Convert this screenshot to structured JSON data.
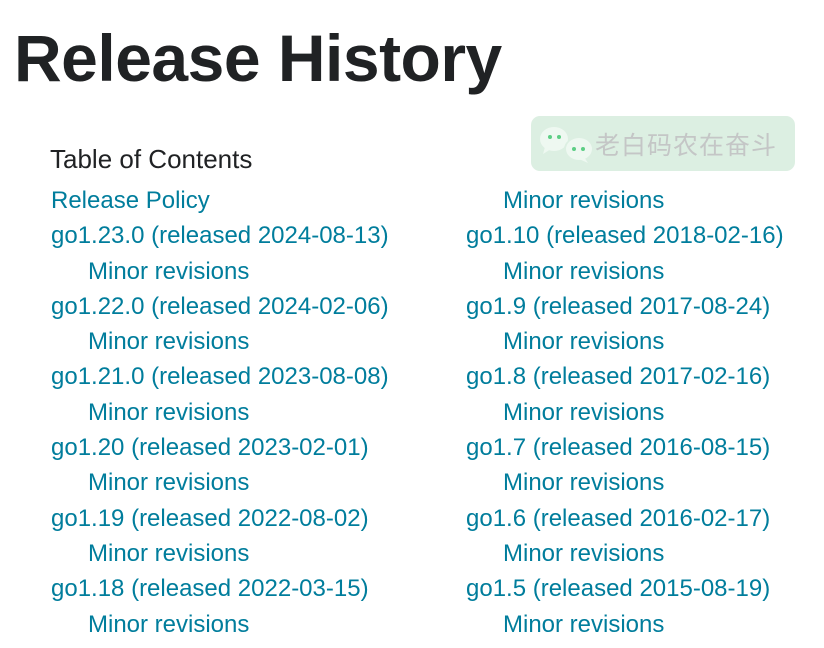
{
  "page": {
    "title": "Release History"
  },
  "toc": {
    "heading": "Table of Contents",
    "left_column": [
      {
        "label": "Release Policy",
        "level": 1
      },
      {
        "label": "go1.23.0 (released 2024-08-13)",
        "level": 1
      },
      {
        "label": "Minor revisions",
        "level": 2
      },
      {
        "label": "go1.22.0 (released 2024-02-06)",
        "level": 1
      },
      {
        "label": "Minor revisions",
        "level": 2
      },
      {
        "label": "go1.21.0 (released 2023-08-08)",
        "level": 1
      },
      {
        "label": "Minor revisions",
        "level": 2
      },
      {
        "label": "go1.20 (released 2023-02-01)",
        "level": 1
      },
      {
        "label": "Minor revisions",
        "level": 2
      },
      {
        "label": "go1.19 (released 2022-08-02)",
        "level": 1
      },
      {
        "label": "Minor revisions",
        "level": 2
      },
      {
        "label": "go1.18 (released 2022-03-15)",
        "level": 1
      },
      {
        "label": "Minor revisions",
        "level": 2
      }
    ],
    "right_column": [
      {
        "label": "Minor revisions",
        "level": 2
      },
      {
        "label": "go1.10 (released 2018-02-16)",
        "level": 1
      },
      {
        "label": "Minor revisions",
        "level": 2
      },
      {
        "label": "go1.9 (released 2017-08-24)",
        "level": 1
      },
      {
        "label": "Minor revisions",
        "level": 2
      },
      {
        "label": "go1.8 (released 2017-02-16)",
        "level": 1
      },
      {
        "label": "Minor revisions",
        "level": 2
      },
      {
        "label": "go1.7 (released 2016-08-15)",
        "level": 1
      },
      {
        "label": "Minor revisions",
        "level": 2
      },
      {
        "label": "go1.6 (released 2016-02-17)",
        "level": 1
      },
      {
        "label": "Minor revisions",
        "level": 2
      },
      {
        "label": "go1.5 (released 2015-08-19)",
        "level": 1
      },
      {
        "label": "Minor revisions",
        "level": 2
      }
    ]
  },
  "watermark": {
    "icon": "wechat-icon",
    "text": "老白码农在奋斗"
  },
  "colors": {
    "link": "#007d9c",
    "heading": "#202224",
    "watermark_bg": "#dcefe2",
    "watermark_icon_dots": "#5dce85"
  }
}
